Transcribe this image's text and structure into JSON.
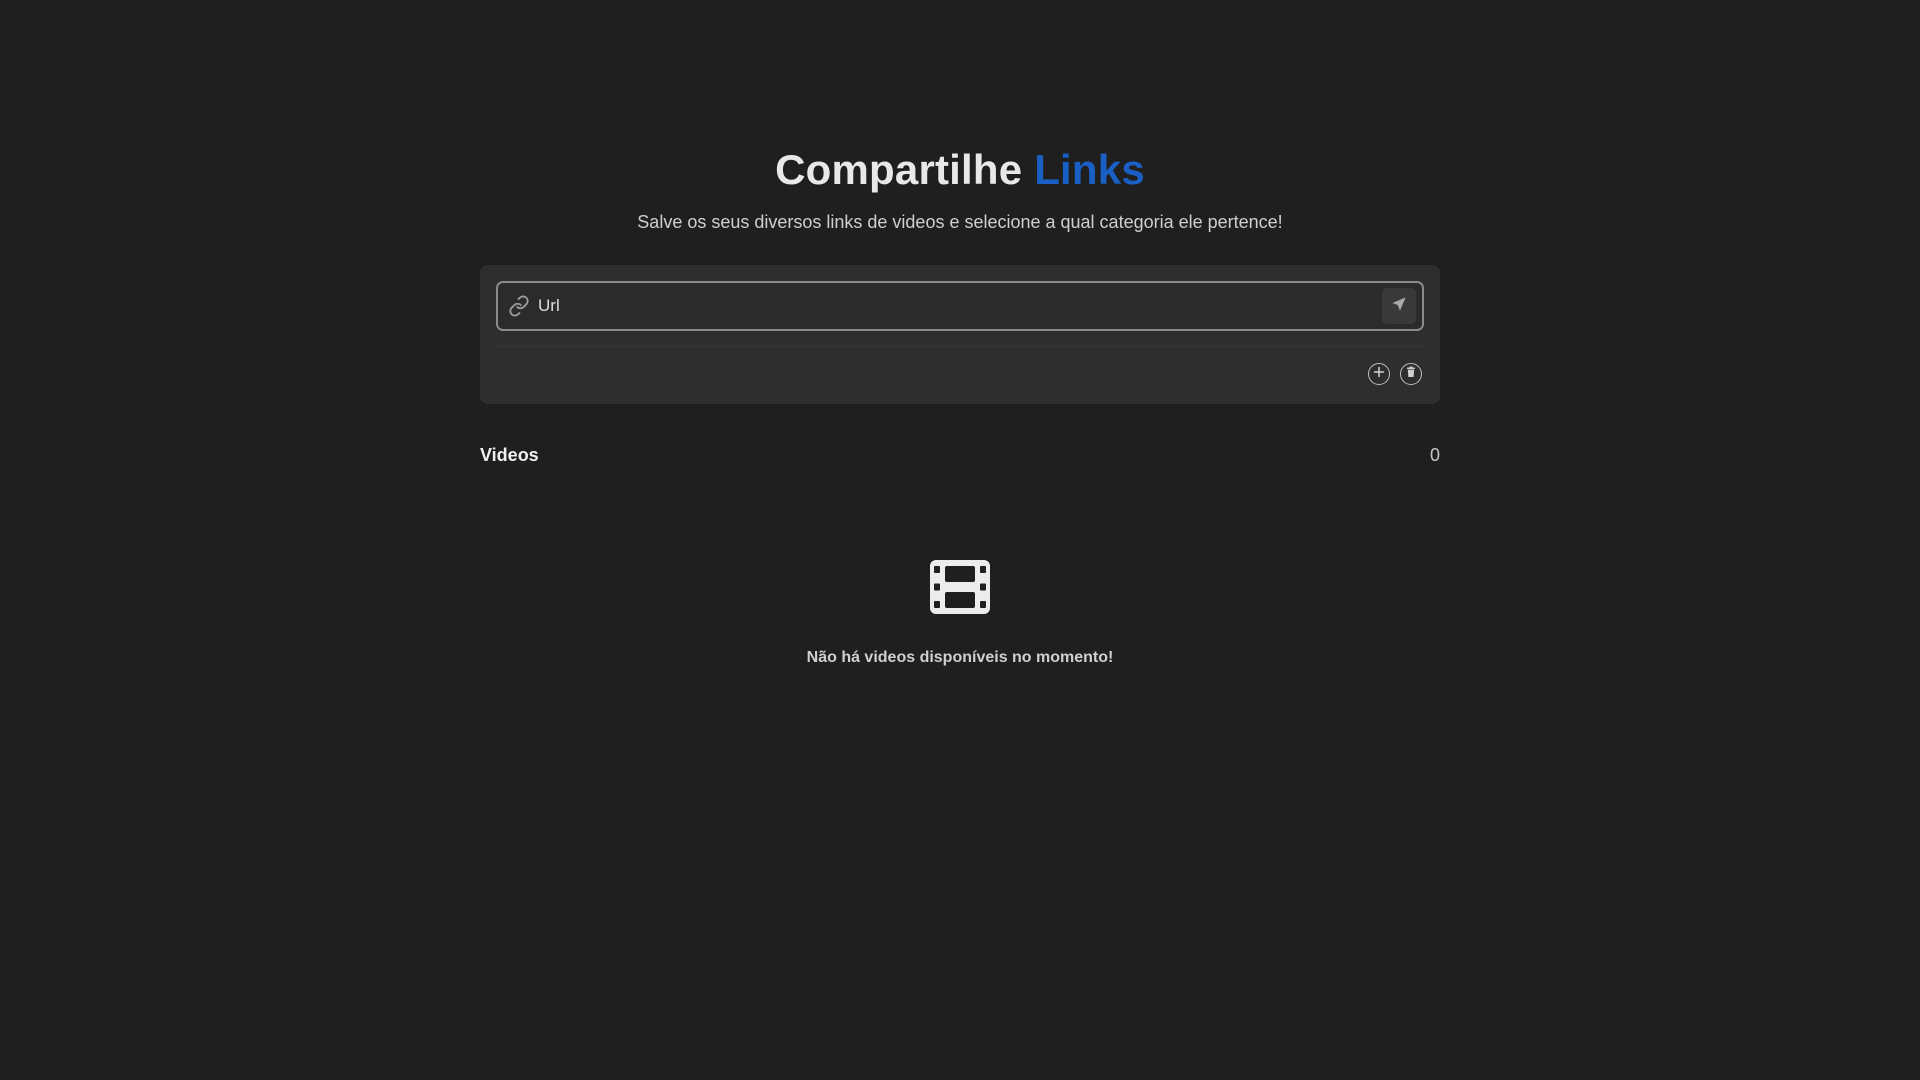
{
  "header": {
    "title_main": "Compartilhe",
    "title_accent": "Links",
    "subtitle": "Salve os seus diversos links de videos e selecione a qual categoria ele pertence!"
  },
  "form": {
    "url_placeholder": "Url",
    "url_value": "",
    "icons": {
      "link": "link-icon",
      "send": "send-icon",
      "add": "plus-circle-icon",
      "delete": "trash-circle-icon"
    }
  },
  "videos": {
    "title": "Videos",
    "count": "0",
    "empty_message": "Não há videos disponíveis no momento!",
    "empty_icon": "film-icon"
  },
  "colors": {
    "background": "#1f1f1f",
    "card": "#2e2e2e",
    "accent": "#1a5fc4",
    "text": "#e8e8e8"
  }
}
